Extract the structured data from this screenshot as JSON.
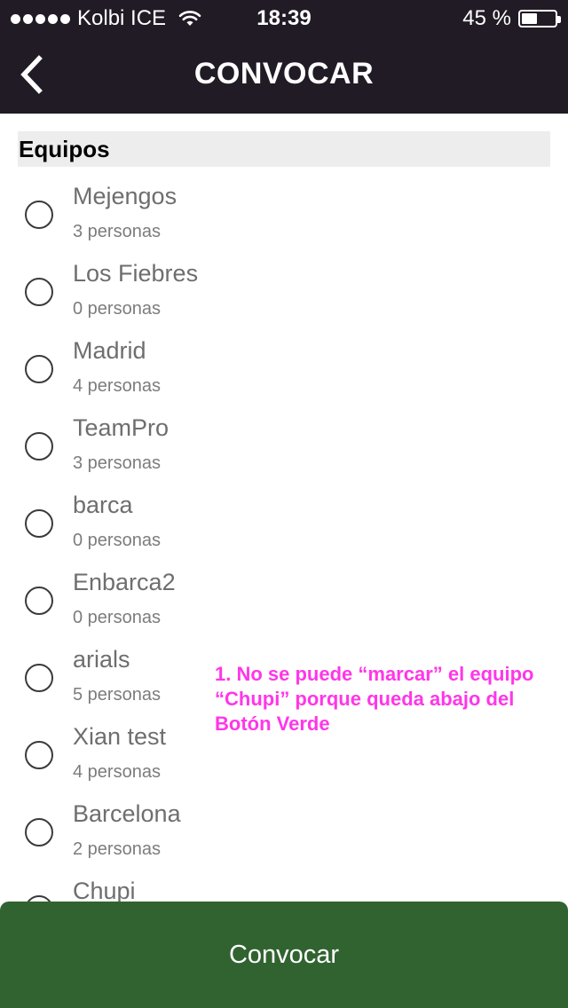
{
  "status_bar": {
    "carrier": "Kolbi ICE",
    "time": "18:39",
    "battery": "45 %",
    "battery_level": 0.45
  },
  "nav": {
    "title": "CONVOCAR",
    "back_icon": "chevron-left-icon"
  },
  "section": {
    "title": "Equipos"
  },
  "teams": [
    {
      "name": "Mejengos",
      "count": "3 personas",
      "selected": false
    },
    {
      "name": "Los Fiebres",
      "count": "0 personas",
      "selected": false
    },
    {
      "name": "Madrid",
      "count": "4 personas",
      "selected": false
    },
    {
      "name": "TeamPro",
      "count": "3 personas",
      "selected": false
    },
    {
      "name": "barca",
      "count": "0 personas",
      "selected": false
    },
    {
      "name": "Enbarca2",
      "count": "0 personas",
      "selected": false
    },
    {
      "name": "arials",
      "count": "5 personas",
      "selected": false
    },
    {
      "name": "Xian test",
      "count": "4 personas",
      "selected": false
    },
    {
      "name": "Barcelona",
      "count": "2 personas",
      "selected": false
    },
    {
      "name": "Chupi",
      "count": "",
      "selected": false
    }
  ],
  "annotation": {
    "text": "1. No se puede “marcar” el equipo “Chupi” porque queda abajo del Botón Verde",
    "color": "#ff36e8"
  },
  "footer": {
    "button_label": "Convocar",
    "button_color": "#316331"
  },
  "colors": {
    "bar_background": "#211b26",
    "section_background": "#ededed"
  }
}
